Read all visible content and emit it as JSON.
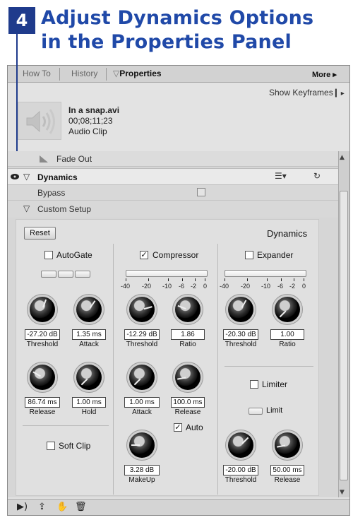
{
  "heading": {
    "step": "4",
    "line1": "Adjust Dynamics Options",
    "line2": "in the Properties Panel"
  },
  "tabs": [
    {
      "label": "How To",
      "active": false
    },
    {
      "label": "History",
      "active": false
    },
    {
      "label": "Properties",
      "active": true
    }
  ],
  "more_label": "More ▸",
  "show_keyframes": "Show Keyframes",
  "clip": {
    "name": "In a snap.avi",
    "timecode": "00;08;11;23",
    "type": "Audio Clip"
  },
  "effects": {
    "fade_out": "Fade Out",
    "dynamics": "Dynamics",
    "bypass": "Bypass",
    "custom_setup": "Custom Setup"
  },
  "custom": {
    "reset": "Reset",
    "header": "Dynamics",
    "autogate": {
      "label": "AutoGate",
      "checked": false,
      "threshold": "-27.20 dB",
      "threshold_label": "Threshold",
      "attack": "1.35 ms",
      "attack_label": "Attack",
      "release": "86.74 ms",
      "release_label": "Release",
      "hold": "1.00 ms",
      "hold_label": "Hold"
    },
    "compressor": {
      "label": "Compressor",
      "checked": true,
      "threshold": "-12.29 dB",
      "threshold_label": "Threshold",
      "ratio": "1.86",
      "ratio_label": "Ratio",
      "attack": "1.00 ms",
      "attack_label": "Attack",
      "release": "100.0 ms",
      "release_label": "Release",
      "auto": "Auto",
      "auto_checked": true,
      "makeup": "3.28 dB",
      "makeup_label": "MakeUp"
    },
    "expander": {
      "label": "Expander",
      "checked": false,
      "threshold": "-20.30 dB",
      "threshold_label": "Threshold",
      "ratio": "1.00",
      "ratio_label": "Ratio"
    },
    "limiter": {
      "label": "Limiter",
      "checked": false,
      "limit": "Limit",
      "threshold": "-20.00 dB",
      "threshold_label": "Threshold",
      "release": "50.00 ms",
      "release_label": "Release"
    },
    "soft_clip": {
      "label": "Soft Clip",
      "checked": false
    },
    "meter_scale": [
      "-40",
      "-20",
      "-10",
      "-6",
      "-2",
      "0"
    ]
  },
  "colors": {
    "heading_blue": "#2049a8",
    "badge_blue": "#1f3b8c"
  },
  "icons": [
    "speaker-icon",
    "eye-icon",
    "settings-icon",
    "reset-icon",
    "play-icon",
    "export-icon",
    "hand-icon",
    "trash-icon"
  ]
}
